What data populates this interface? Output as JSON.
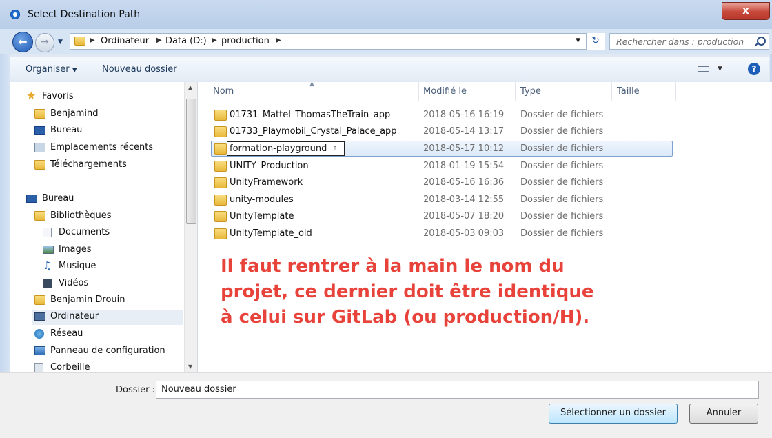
{
  "window": {
    "title": "Select Destination Path",
    "close_label": "x"
  },
  "address": {
    "breadcrumbs": [
      "Ordinateur",
      "Data (D:)",
      "production"
    ],
    "search_placeholder": "Rechercher dans : production"
  },
  "toolbar": {
    "organize_label": "Organiser",
    "new_folder_label": "Nouveau dossier"
  },
  "nav": {
    "items": [
      {
        "label": "Favoris",
        "icon": "star-icon"
      },
      {
        "label": "Benjamind",
        "icon": "folder-icon"
      },
      {
        "label": "Bureau",
        "icon": "desktop-icon"
      },
      {
        "label": "Emplacements récents",
        "icon": "recent-places-icon"
      },
      {
        "label": "Téléchargements",
        "icon": "downloads-icon"
      },
      {
        "label": "Bureau",
        "icon": "desktop-icon"
      },
      {
        "label": "Bibliothèques",
        "icon": "libraries-icon"
      },
      {
        "label": "Documents",
        "icon": "documents-icon"
      },
      {
        "label": "Images",
        "icon": "images-icon"
      },
      {
        "label": "Musique",
        "icon": "music-icon"
      },
      {
        "label": "Vidéos",
        "icon": "videos-icon"
      },
      {
        "label": "Benjamin Drouin",
        "icon": "user-folder-icon"
      },
      {
        "label": "Ordinateur",
        "icon": "computer-icon"
      },
      {
        "label": "Réseau",
        "icon": "network-icon"
      },
      {
        "label": "Panneau de configuration",
        "icon": "control-panel-icon"
      },
      {
        "label": "Corbeille",
        "icon": "recycle-bin-icon"
      }
    ]
  },
  "columns": {
    "name": "Nom",
    "modified": "Modifié le",
    "type": "Type",
    "size": "Taille"
  },
  "files": [
    {
      "name": "01731_Mattel_ThomasTheTrain_app",
      "modified": "2018-05-16 16:19",
      "type": "Dossier de fichiers"
    },
    {
      "name": "01733_Playmobil_Crystal_Palace_app",
      "modified": "2018-05-14 13:17",
      "type": "Dossier de fichiers"
    },
    {
      "name": "formation-playground",
      "modified": "2018-05-17 10:12",
      "type": "Dossier de fichiers"
    },
    {
      "name": "UNITY_Production",
      "modified": "2018-01-19 15:54",
      "type": "Dossier de fichiers"
    },
    {
      "name": "UnityFramework",
      "modified": "2018-05-16 16:36",
      "type": "Dossier de fichiers"
    },
    {
      "name": "unity-modules",
      "modified": "2018-03-14 12:55",
      "type": "Dossier de fichiers"
    },
    {
      "name": "UnityTemplate",
      "modified": "2018-05-07 18:20",
      "type": "Dossier de fichiers"
    },
    {
      "name": "UnityTemplate_old",
      "modified": "2018-05-03 09:03",
      "type": "Dossier de fichiers"
    }
  ],
  "annotation": {
    "line1": "Il faut rentrer à la main le nom du",
    "line2": "projet, ce dernier doit être identique",
    "line3": "à celui sur GitLab (ou production/H)."
  },
  "footer": {
    "folder_label": "Dossier :",
    "folder_value": "Nouveau dossier",
    "select_label": "Sélectionner un dossier",
    "cancel_label": "Annuler"
  },
  "colors": {
    "annotation": "#e8433b",
    "selection": "#dce9f8",
    "folder": "#e8b93b"
  }
}
